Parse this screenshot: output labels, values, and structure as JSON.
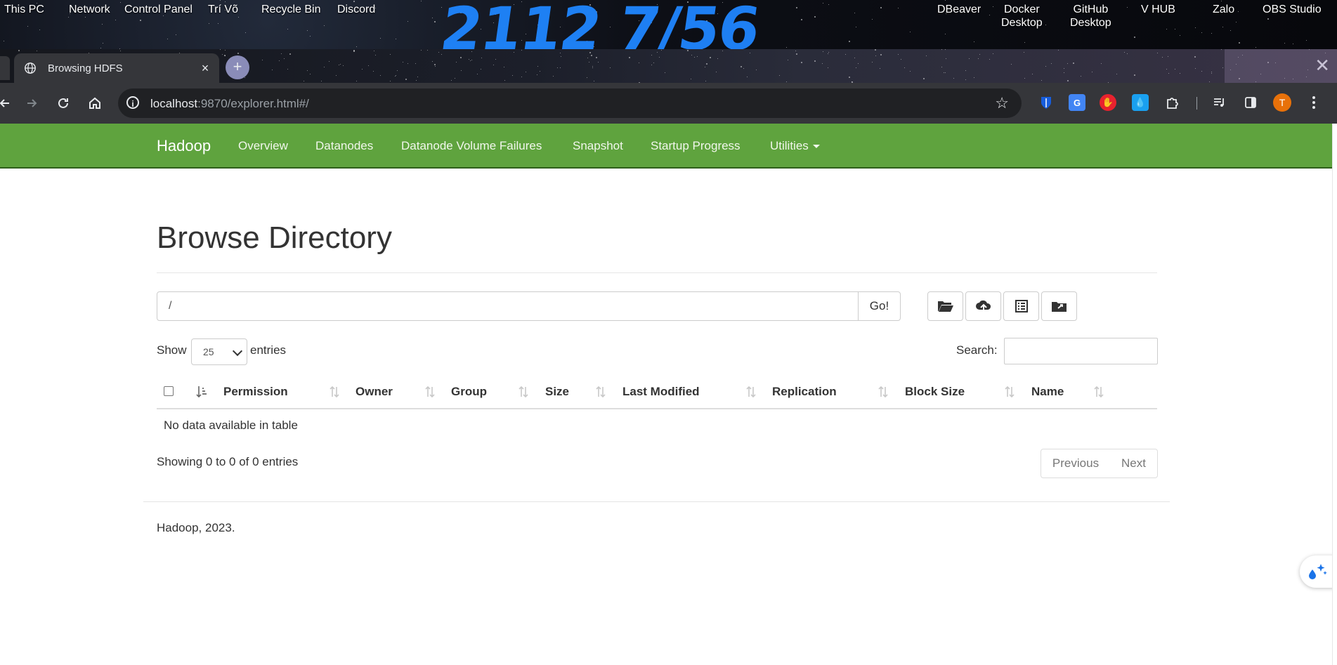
{
  "desktop": {
    "icons": [
      {
        "label": "This PC"
      },
      {
        "label": "Network"
      },
      {
        "label": "Control Panel"
      },
      {
        "label": "Trí Võ"
      },
      {
        "label": "Recycle Bin"
      },
      {
        "label": "Discord"
      },
      {
        "label": "DBeaver"
      },
      {
        "label": "Docker\nDesktop"
      },
      {
        "label": "GitHub\nDesktop"
      },
      {
        "label": "V HUB"
      },
      {
        "label": "Zalo"
      },
      {
        "label": "OBS Studio"
      }
    ],
    "wallpaper_number": "2112 7/56"
  },
  "browser": {
    "tab": {
      "title": "Browsing HDFS",
      "icon": "globe-icon",
      "close": "×"
    },
    "new_tab": "+",
    "url_host": "localhost",
    "url_rest": ":9870/explorer.html#/",
    "info_icon": "i",
    "profile_initial": "T",
    "extensions": [
      "bitwarden-icon",
      "google-translate-icon",
      "adblock-icon",
      "drop-icon",
      "extensions-icon",
      "media-control-icon",
      "side-panel-icon"
    ]
  },
  "navbar": {
    "brand": "Hadoop",
    "items": [
      "Overview",
      "Datanodes",
      "Datanode Volume Failures",
      "Snapshot",
      "Startup Progress",
      "Utilities"
    ]
  },
  "page": {
    "title": "Browse Directory",
    "path_value": "/",
    "go_label": "Go!",
    "show_label": "Show",
    "entries_value": "25",
    "entries_label": "entries",
    "search_label": "Search:",
    "columns": [
      "Permission",
      "Owner",
      "Group",
      "Size",
      "Last Modified",
      "Replication",
      "Block Size",
      "Name"
    ],
    "empty_message": "No data available in table",
    "info": "Showing 0 to 0 of 0 entries",
    "prev_label": "Previous",
    "next_label": "Next",
    "footer": "Hadoop, 2023."
  },
  "colors": {
    "navbar": "#5fa33e",
    "chrome_toolbar": "#35363a",
    "omnibox": "#202124",
    "wallpaper_digits": "#1f86ff"
  }
}
